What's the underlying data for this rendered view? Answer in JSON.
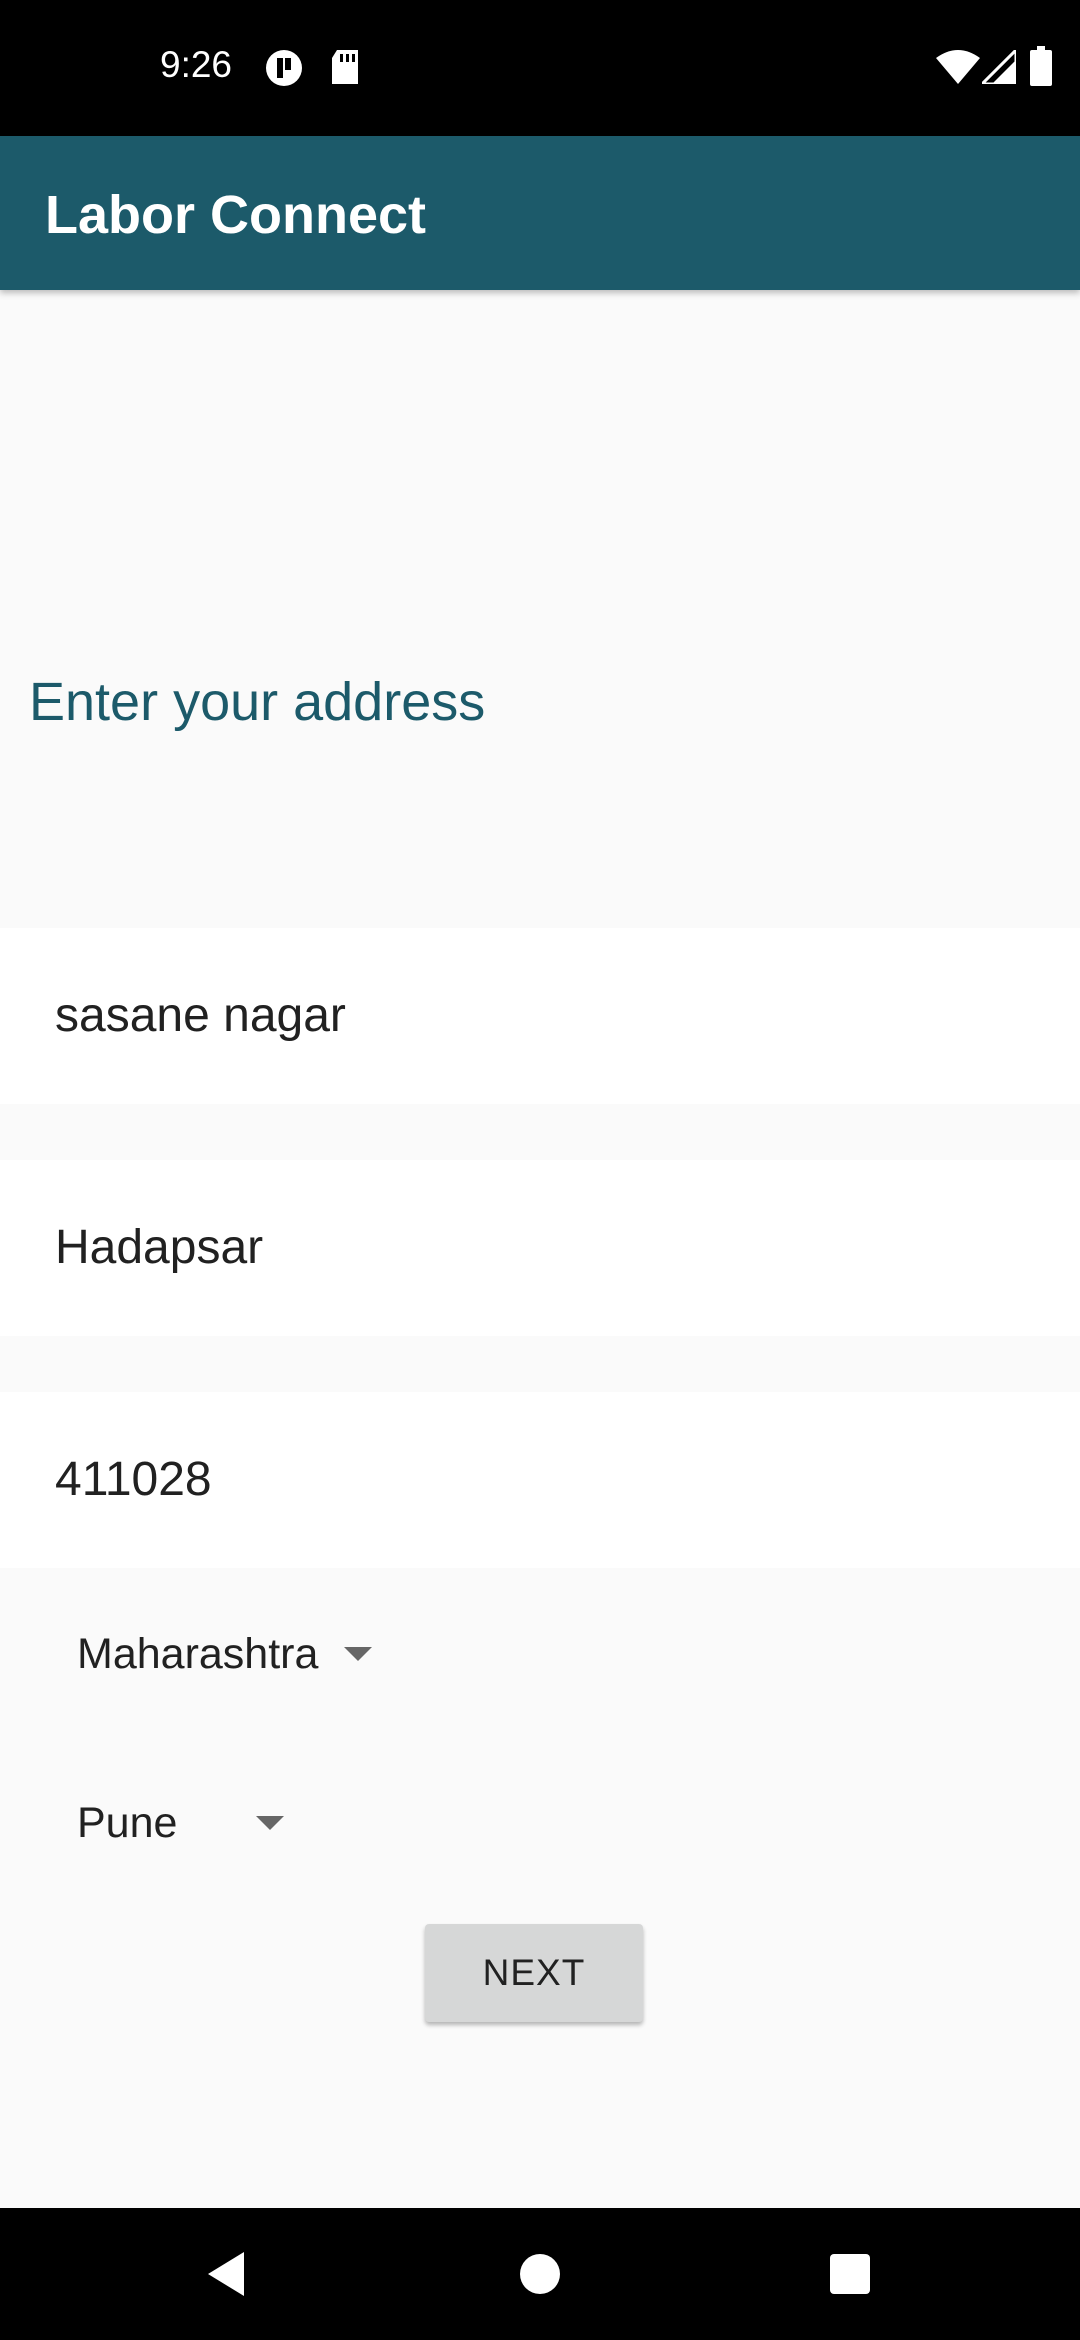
{
  "status_bar": {
    "time": "9:26",
    "icons": [
      "vpn-key-icon",
      "sd-card-icon",
      "wifi-icon",
      "cell-signal-icon",
      "battery-icon"
    ]
  },
  "app_bar": {
    "title": "Labor Connect",
    "color": "#1c5a6a"
  },
  "form": {
    "heading": "Enter your address",
    "address_line": "sasane nagar",
    "area": "Hadapsar",
    "pincode": "411028",
    "state": "Maharashtra",
    "city": "Pune",
    "next_label": "NEXT"
  },
  "nav_bar": {
    "icons": [
      "back-icon",
      "home-icon",
      "recents-icon"
    ]
  }
}
